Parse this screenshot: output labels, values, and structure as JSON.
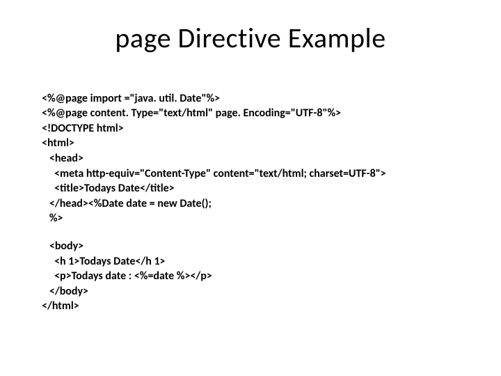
{
  "title": "page Directive Example",
  "code": {
    "l1": "<%@page import =\"java. util. Date\"%>",
    "l2": "<%@page content. Type=\"text/html\" page. Encoding=\"UTF-8\"%>",
    "l3": "<!DOCTYPE html>",
    "l4": "<html>",
    "l5": "   <head>",
    "l6": "     <meta http-equiv=\"Content-Type\" content=\"text/html; charset=UTF-8\">",
    "l7": "     <title>Todays Date</title>",
    "l8": "   </head><%Date date = new Date();",
    "l9": "   %>",
    "l10": "   <body>",
    "l11": "     <h 1>Todays Date</h 1>",
    "l12": "     <p>Todays date : <%=date %></p>",
    "l13": "   </body>",
    "l14": "</html>"
  }
}
